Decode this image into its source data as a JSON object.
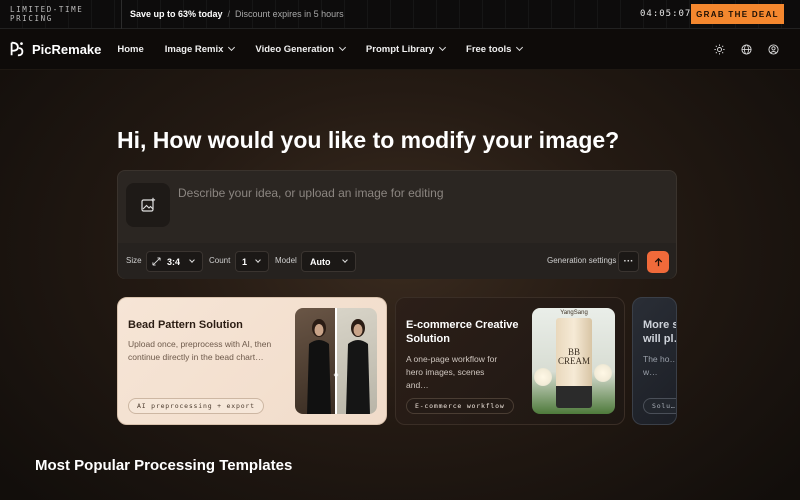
{
  "promo": {
    "tag": "LIMITED-TIME PRICING",
    "main": "Save up to 63% today",
    "separator": "/",
    "sub": "Discount expires in 5 hours",
    "timer": "04:05:07",
    "cta": "GRAB THE DEAL"
  },
  "nav": {
    "brand": "PicRemake",
    "items": [
      {
        "label": "Home",
        "dropdown": false
      },
      {
        "label": "Image Remix",
        "dropdown": true
      },
      {
        "label": "Video Generation",
        "dropdown": true
      },
      {
        "label": "Prompt Library",
        "dropdown": true
      },
      {
        "label": "Free tools",
        "dropdown": true
      }
    ],
    "icons": [
      "theme-sun-icon",
      "globe-icon",
      "user-icon"
    ]
  },
  "hero": {
    "title": "Hi, How would you like to modify your image?",
    "placeholder": "Describe your idea, or upload an image for editing",
    "value": "",
    "toolbar": {
      "size_label": "Size",
      "size_value": "3:4",
      "count_label": "Count",
      "count_value": "1",
      "model_label": "Model",
      "model_value": "Auto",
      "settings_label": "Generation settings",
      "more_label": "···"
    }
  },
  "cards": [
    {
      "title": "Bead Pattern Solution",
      "desc": "Upload once, preprocess with AI, then continue directly in the bead chart…",
      "pill": "AI preprocessing + export"
    },
    {
      "title": "E-commerce Creative Solution",
      "desc": "A one-page workflow for hero images, scenes and…",
      "pill": "E-commerce workflow",
      "product_brand": "YangSang",
      "product_name": "BB CREAM"
    },
    {
      "title": "More s… will pl…",
      "desc": "The ho… three w…",
      "pill": "Solu…"
    }
  ],
  "section": {
    "title": "Most Popular Processing Templates"
  },
  "colors": {
    "accent": "#f4872e",
    "send": "#f06a3a",
    "background": "#1a1410"
  }
}
